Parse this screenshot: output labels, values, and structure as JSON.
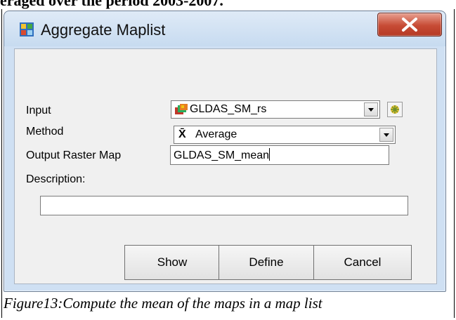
{
  "document": {
    "heading": "eraged over the period 2003-2007.",
    "caption": "Figure13:Compute the mean of the maps in a map list"
  },
  "window": {
    "title": "Aggregate Maplist",
    "close_glyph": "X"
  },
  "form": {
    "input_label": "Input",
    "input_value": "GLDAS_SM_rs",
    "method_label": "Method",
    "method_value": "Average",
    "method_symbol": "X̄",
    "output_label": "Output Raster Map",
    "output_value": "GLDAS_SM_mean",
    "description_label": "Description:",
    "description_value": ""
  },
  "buttons": {
    "show": "Show",
    "define": "Define",
    "cancel": "Cancel"
  },
  "icons": [
    "app-icon",
    "maplist-icon",
    "mean-symbol-icon",
    "dropdown-arrow-icon",
    "browse-icon",
    "close-icon"
  ]
}
